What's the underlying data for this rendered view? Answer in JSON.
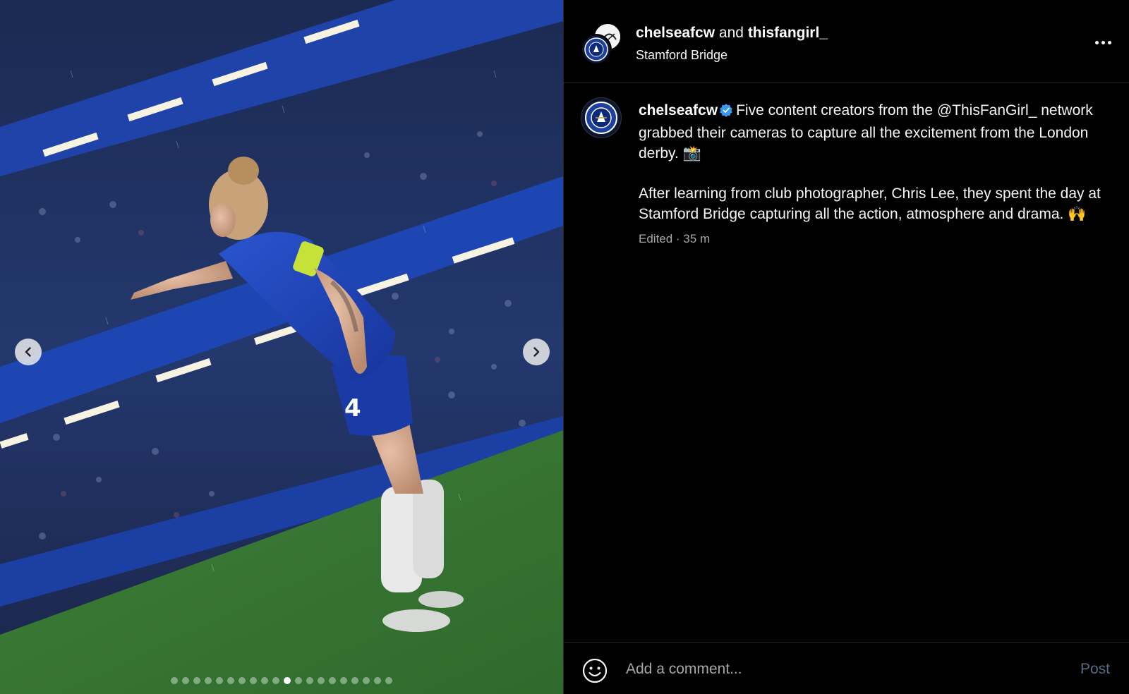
{
  "header": {
    "author": "chelseafcw",
    "connector": "and",
    "collaborator": "thisfangirl_",
    "location": "Stamford Bridge",
    "more_icon": "more-horizontal-icon"
  },
  "caption": {
    "username": "chelseafcw",
    "verified_icon": "verified-badge-icon",
    "paragraph1": "Five content creators from the @ThisFanGirl_ network grabbed their cameras to capture all the excitement from the London derby. 📸",
    "paragraph2": "After learning from club photographer, Chris Lee, they spent the day at Stamford Bridge capturing all the action, atmosphere and drama. 🙌",
    "meta": "Edited · 35 m"
  },
  "carousel": {
    "total_slides": 20,
    "active_index": 10,
    "prev_icon": "chevron-left-icon",
    "next_icon": "chevron-right-icon"
  },
  "comment": {
    "placeholder": "Add a comment...",
    "post_label": "Post",
    "emoji_icon": "smiley-icon"
  },
  "colors": {
    "background": "#000000",
    "accent_blue": "#1d4bb8",
    "verified_blue": "#3897f0",
    "post_disabled": "#5a6a85"
  }
}
